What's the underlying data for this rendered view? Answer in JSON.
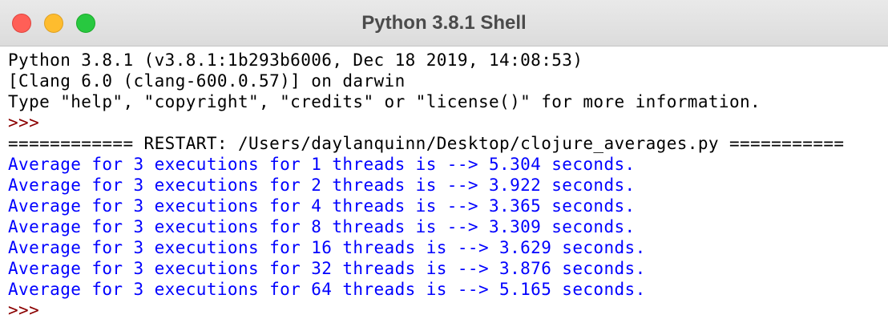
{
  "window": {
    "title": "Python 3.8.1 Shell"
  },
  "shell": {
    "banner": [
      "Python 3.8.1 (v3.8.1:1b293b6006, Dec 18 2019, 14:08:53)",
      "[Clang 6.0 (clang-600.0.57)] on darwin",
      "Type \"help\", \"copyright\", \"credits\" or \"license()\" for more information."
    ],
    "prompt": ">>>",
    "restart": "============ RESTART: /Users/daylanquinn/Desktop/clojure_averages.py ===========",
    "output": [
      "Average for 3 executions for 1 threads is --> 5.304 seconds.",
      "Average for 3 executions for 2 threads is --> 3.922 seconds.",
      "Average for 3 executions for 4 threads is --> 3.365 seconds.",
      "Average for 3 executions for 8 threads is --> 3.309 seconds.",
      "Average for 3 executions for 16 threads is --> 3.629 seconds.",
      "Average for 3 executions for 32 threads is --> 3.876 seconds.",
      "Average for 3 executions for 64 threads is --> 5.165 seconds."
    ],
    "final_prompt": ">>>"
  },
  "colors": {
    "stdout": "#0000ff",
    "prompt": "#8b0000",
    "text": "#000000",
    "close": "#ff5f57",
    "minimize": "#febc2e",
    "maximize": "#28c840"
  }
}
